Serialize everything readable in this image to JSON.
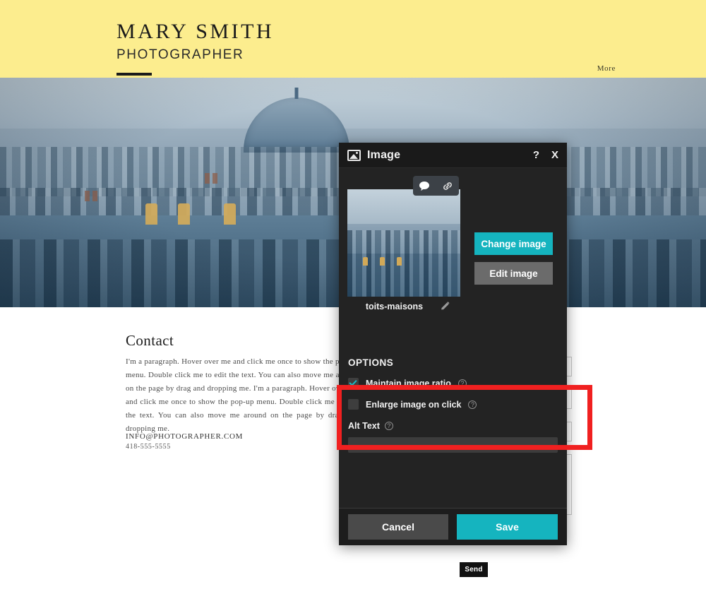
{
  "site": {
    "brand_name": "MARY SMITH",
    "brand_role": "PHOTOGRAPHER",
    "nav_more": "More",
    "accent_yellow": "#fced8e"
  },
  "hero": {
    "alt": "paris-rooftops-photo"
  },
  "contact": {
    "heading": "Contact",
    "paragraph": "I'm a paragraph. Hover over me and click me once to show the pop-up menu. Double click me to edit the text. You can also move me around on the page by drag and dropping me. I'm a paragraph. Hover over me and click me once to show the pop-up menu. Double click me to edit the text. You can also move me around on the page by drag and dropping me.",
    "email": "INFO@PHOTOGRAPHER.COM",
    "phone": "418-555-5555",
    "send_label": "Send"
  },
  "dialog": {
    "title": "Image",
    "help_label": "?",
    "close_label": "X",
    "title_icon": "image-icon",
    "thumbnail": {
      "comment_icon": "speech-bubble-icon",
      "link_icon": "chain-link-icon",
      "filename": "toits-maisons",
      "edit_icon": "pencil-icon"
    },
    "change_image_label": "Change image",
    "edit_image_label": "Edit image",
    "options_heading": "OPTIONS",
    "options": [
      {
        "label": "Maintain image ratio",
        "checked": true,
        "help": "?"
      },
      {
        "label": "Enlarge image on click",
        "checked": false,
        "help": "?"
      }
    ],
    "alt_text": {
      "label": "Alt Text",
      "help": "?",
      "value": "",
      "placeholder": ""
    },
    "cancel_label": "Cancel",
    "save_label": "Save",
    "accent_teal": "#15b4bf",
    "background": "#232323"
  },
  "annotation": {
    "color": "#f02020",
    "target": "alt-text-field"
  }
}
